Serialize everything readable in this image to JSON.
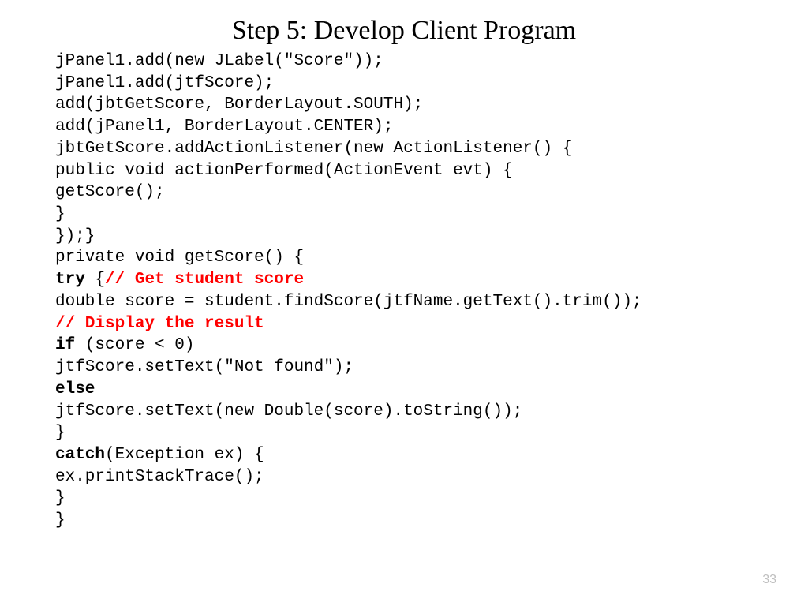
{
  "slide": {
    "title": "Step 5: Develop Client Program",
    "page_number": "33",
    "code": {
      "line1": "jPanel1.add(new JLabel(\"Score\"));",
      "line2": "jPanel1.add(jtfScore);",
      "line3": "add(jbtGetScore, BorderLayout.SOUTH);",
      "line4": "add(jPanel1, BorderLayout.CENTER);",
      "line5": "jbtGetScore.addActionListener(new ActionListener() {",
      "line6": "public void actionPerformed(ActionEvent evt) {",
      "line7": "getScore();",
      "line8": "}",
      "line9": "});}",
      "line10": "private void getScore() {",
      "line11_try": "try ",
      "line11_brace": "{",
      "line11_comment": "// Get student score",
      "line12": "double score = student.findScore(jtfName.getText().trim());",
      "line13_comment": "// Display the result",
      "line14_if": "if ",
      "line14_rest": "(score < 0)",
      "line15": "jtfScore.setText(\"Not found\");",
      "line16_else": "else",
      "line17": "jtfScore.setText(new Double(score).toString());",
      "line18": "}",
      "line19_catch": "catch",
      "line19_rest": "(Exception ex) {",
      "line20": "ex.printStackTrace();",
      "line21": "}",
      "line22": "}"
    }
  }
}
